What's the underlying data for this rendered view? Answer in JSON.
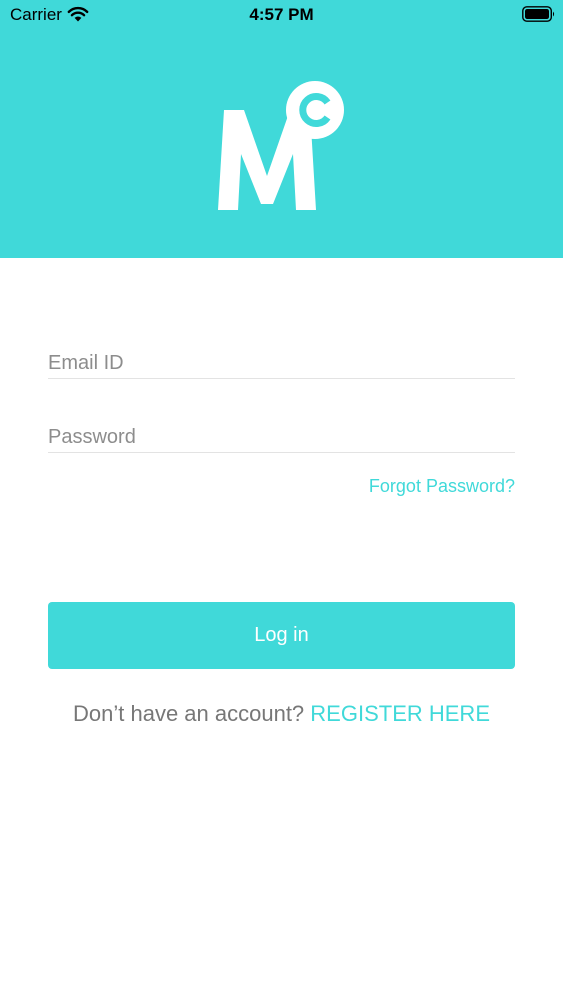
{
  "status_bar": {
    "carrier": "Carrier",
    "time": "4:57 PM",
    "wifi_icon": "wifi-icon",
    "battery_icon": "battery-icon"
  },
  "header": {
    "background_color": "#40D9D9",
    "logo": {
      "letter": "M",
      "superscript": "C",
      "color": "#ffffff"
    }
  },
  "form": {
    "email": {
      "placeholder": "Email ID",
      "value": ""
    },
    "password": {
      "placeholder": "Password",
      "value": ""
    },
    "forgot_label": "Forgot Password?",
    "login_label": "Log in",
    "register_prompt": "Don’t have an account?",
    "register_link": "REGISTER HERE"
  },
  "colors": {
    "accent": "#40D9D9",
    "muted_text": "#777777",
    "divider": "#e3e3e3"
  }
}
